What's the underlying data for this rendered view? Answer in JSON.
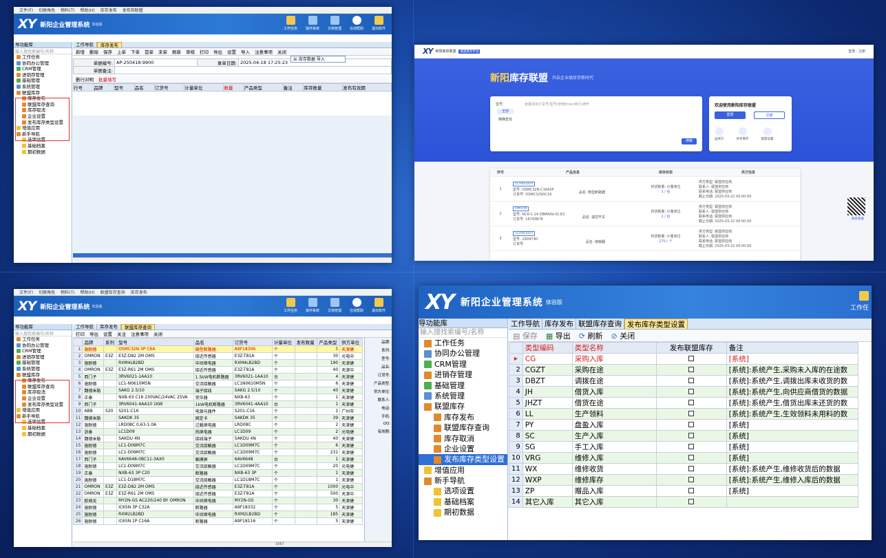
{
  "app": {
    "menus": [
      "文件(F)",
      "切换角色",
      "物料(T)",
      "帮助(H)",
      "库存发布",
      "发布到联盟"
    ],
    "title": "新阳企业管理系统",
    "trial": "体验版",
    "header_buttons": [
      "工作任务",
      "操作系统",
      "文档管理",
      "在线帮助",
      "退出软件"
    ],
    "logo": "XY",
    "sidebar_header": "导功能库",
    "sidebar_search": "输入搜找索编号/名称",
    "tree": [
      {
        "label": "工作任务",
        "level": 0,
        "icon": "task-icon"
      },
      {
        "label": "协同办公管理",
        "level": 0,
        "icon": "office-icon"
      },
      {
        "label": "CRM管理",
        "level": 0,
        "icon": "crm-icon"
      },
      {
        "label": "进销存管理",
        "level": 0,
        "icon": "stock-icon"
      },
      {
        "label": "基础管理",
        "level": 0,
        "icon": "base-icon"
      },
      {
        "label": "系统管理",
        "level": 0,
        "icon": "system-icon"
      },
      {
        "label": "联盟库存",
        "level": 0,
        "icon": "union-icon"
      },
      {
        "label": "库存发布",
        "level": 1,
        "icon": "publish-icon"
      },
      {
        "label": "联盟库存查询",
        "level": 1,
        "icon": "query-icon"
      },
      {
        "label": "库存取消",
        "level": 1,
        "icon": "cancel-icon"
      },
      {
        "label": "企业设置",
        "level": 1,
        "icon": "company-icon"
      },
      {
        "label": "发布库存类型设置",
        "level": 1,
        "icon": "type-icon"
      },
      {
        "label": "增值应用",
        "level": 0,
        "icon": "app-icon"
      },
      {
        "label": "新手导航",
        "level": 0,
        "icon": "guide-icon"
      },
      {
        "label": "选项设置",
        "level": 1,
        "icon": "folder-icon"
      },
      {
        "label": "基础档案",
        "level": 1,
        "icon": "folder-icon"
      },
      {
        "label": "期初数据",
        "level": 1,
        "icon": "folder-icon"
      }
    ]
  },
  "p1": {
    "tabs": [
      "工作导航",
      "库存发布"
    ],
    "toolbar": [
      "新增",
      "删除",
      "保存",
      "上单",
      "下单",
      "首单",
      "末单",
      "刷新",
      "审核",
      "打印",
      "导出",
      "设置",
      "导入",
      "注意事项",
      "关闭"
    ],
    "import_menu": "从 库存数据 导入",
    "form": {
      "doc_no_label": "单据编号:",
      "doc_no": "AP-250418-9900",
      "date_label": "录单日期:",
      "date": "2025-04-18 17:25:23",
      "remark_label": "单据备注:"
    },
    "subbar": [
      "删行对明",
      "批量填写"
    ],
    "columns": [
      "行号",
      "品牌",
      "型号",
      "品名",
      "订货号",
      "计量单位",
      "数量",
      "产品类型",
      "备注",
      "库存数量",
      "发布有效期"
    ]
  },
  "p2": {
    "top_left": "新阳库存联盟",
    "top_badge": "联盟库存平台",
    "top_right": "登录 · 注册",
    "hero_title_a": "新阳",
    "hero_title_b": "库存联盟",
    "hero_sub": "开启企业级库存新时代",
    "search_label": "型号:",
    "search_placeholder": "批量添加订货号/型号(使用Enter换行)搜开",
    "tab_a": "全部",
    "tab_b": "精确查找",
    "search_btn": "搜索",
    "welcome": "欢迎使用新阳库存联盟",
    "login_btn": "登录",
    "register_btn": "注册",
    "quick": [
      "品牌方",
      "共享库存",
      "联盟设置"
    ],
    "cols": [
      "序号",
      "产品信息",
      "库存状态",
      "供方信息"
    ],
    "rows": [
      {
        "no": "1",
        "brand": "SCHNEIDER",
        "model": "型号: OSMC32N-C16A3P",
        "order": "订货号: OSMC32N3C16",
        "name": "品名: 微型断路器",
        "stock": "供货数量: 计量单位",
        "qty": "1 / 台",
        "supplier": "供方类型: 联盟供应商",
        "contact": "联系人: 联盟供应商",
        "phone": "联系电话: 联盟供应商",
        "update": "截止日期: 2025-03-22 00:00:00"
      },
      {
        "no": "2",
        "brand": "OMRON",
        "model": "型号: NCR-C-24 DBMAIN-01-E2",
        "order": "订货号: 16793B76",
        "name": "品名: 温控开关",
        "stock": "供货数量: 计量单位",
        "qty": "1 / 台",
        "supplier": "供方类型: 联盟供应商",
        "contact": "联系人: 联盟供应商",
        "phone": "联系电话: 联盟供应商",
        "update": "截止日期: 2025-03-22 00:00:00"
      },
      {
        "no": "3",
        "brand": "SCHNEIDER",
        "model": "型号: 29D8740",
        "order": "订货号:",
        "name": "品名: 接触器",
        "stock": "供货数量: 计量单位",
        "qty": "170 / 个",
        "supplier": "供方类型: 联盟供应商",
        "contact": "联系人: 联盟供应商",
        "phone": "联系电话: 联盟供应商",
        "update": "截止日期: 2025-03-22 00:00:00"
      }
    ],
    "qr_label": "联系客服"
  },
  "p3": {
    "tabs": [
      "工作导航",
      "库存发布",
      "联盟库存查询"
    ],
    "toolbar": [
      "打印",
      "导出",
      "设置",
      "关注",
      "注意事项",
      "关闭"
    ],
    "columns": [
      "品牌",
      "系列",
      "型号",
      "品名",
      "订货号",
      "计量单位",
      "发布数量",
      "产品类型",
      "供方单位"
    ],
    "rows": [
      [
        "施耐德",
        "",
        "OSMC32N 3P C6A",
        "微型断路器",
        "A9F18306",
        "个",
        "5",
        "天津捷"
      ],
      [
        "OMRON",
        "E3Z",
        "E3Z-D82 2M OMS",
        "接近传感器",
        "E3Z-T81A",
        "个",
        "30",
        "光电中"
      ],
      [
        "施耐德",
        "",
        "RXM4LB2BD",
        "中间继电器",
        "RXM4LB2BD",
        "个",
        "190",
        "天津捷"
      ],
      [
        "OMRON",
        "E3Z",
        "E3Z-R61 2M OMS",
        "接近传感器",
        "E3Z-T81A",
        "个",
        "40",
        "天津中"
      ],
      [
        "西门子",
        "",
        "3RV6021-1AA10",
        "1.5kW电机断路器",
        "3RV6021-1AA10",
        "台",
        "4",
        "天津捷"
      ],
      [
        "施耐德",
        "",
        "LC1-N0610M5N",
        "交流接触器",
        "LC1N0610M5N",
        "个",
        "6",
        "天津捷"
      ],
      [
        "魏德米勒",
        "",
        "SAKG 2.5/10",
        "端子接线",
        "SAKG 2.5/10",
        "个",
        "40",
        "天津捷"
      ],
      [
        "正泰",
        "",
        "NXB-63 C16 230VAC/24VAC 25VA",
        "变压器",
        "NXB-63",
        "个",
        "1",
        "天津捷"
      ],
      [
        "西门子",
        "",
        "3RV6041-4AA10 1KW",
        "1kW电机断路器",
        "3RV6041-4AA10",
        "台",
        "1",
        "天津捷"
      ],
      [
        "ABB",
        "S20",
        "S201-C16",
        "电源与器件",
        "S201-C16",
        "个",
        "1",
        "广州市"
      ],
      [
        "魏德米勒",
        "",
        "SAKDK 35",
        "固定卡",
        "SAKDK 35",
        "个",
        "39",
        "天津捷"
      ],
      [
        "施耐德",
        "",
        "LRD08C 0.63-1.0A",
        "过载继电器",
        "LRD08C",
        "个",
        "2",
        "天津捷"
      ],
      [
        "浙泰",
        "",
        "LC1D09",
        "热继电器",
        "LC1D09",
        "个",
        "2",
        "光电捷"
      ],
      [
        "魏德米勒",
        "",
        "SAKDU 4N",
        "接线端子",
        "SAKDU 4N",
        "个",
        "40",
        "天津捷"
      ],
      [
        "施耐德",
        "",
        "LC1-D09M7C",
        "交流接触器",
        "LC1D09M7C",
        "个",
        "6",
        "天津捷"
      ],
      [
        "施耐德",
        "",
        "LC1-D09M7C",
        "交流接触器",
        "LC1D09M7C",
        "个",
        "231",
        "天津捷"
      ],
      [
        "西门子",
        "",
        "6AV6648-0BC11-3AX0",
        "触摸屏",
        "6AV6648",
        "台",
        "1",
        "天津捷"
      ],
      [
        "施耐德",
        "",
        "LC1-D09M7C",
        "交流接触器",
        "LC1D09M7C",
        "个",
        "20",
        "光电捷"
      ],
      [
        "正泰",
        "",
        "NXB-63 3P C20",
        "断路器",
        "NXB-63 3P",
        "个",
        "1",
        "天津捷"
      ],
      [
        "施耐德",
        "",
        "LC1-D18M7C",
        "交流接触器",
        "LC1D18M7C",
        "个",
        "1",
        "天津捷"
      ],
      [
        "OMRON",
        "E3Z",
        "E3Z-D82 2M OMS",
        "接近传感器",
        "E3Z-T81A",
        "个",
        "1000",
        "光电中"
      ],
      [
        "OMRON",
        "E3Z",
        "E3Z-R61 2M OMS",
        "接近传感器",
        "E3Z-T81A",
        "个",
        "500",
        "天津中"
      ],
      [
        "欧姆龙",
        "",
        "MY2N-GS AC220/240 BY OMRON",
        "中间继电器",
        "MY2N-GS",
        "个",
        "30",
        "天津捷"
      ],
      [
        "施耐德",
        "",
        "IC65N 3P C32A",
        "断路器",
        "A9F18332",
        "个",
        "5",
        "天津捷"
      ],
      [
        "施耐德",
        "",
        "RXM2LB2BD",
        "中间继电器",
        "RXM2LB2BD",
        "个",
        "185",
        "天津捷"
      ],
      [
        "施耐德",
        "",
        "iC65N 1P C16A",
        "断路器",
        "A9F18116",
        "个",
        "5",
        "天津捷"
      ]
    ],
    "total": "1667",
    "right_labels": [
      "品牌:",
      "系列:",
      "型号:",
      "品名:",
      "订货号:",
      "产品类型:",
      "供方单位:",
      "联系人:",
      "电话:",
      "手机:",
      "QQ:",
      "有效期:"
    ]
  },
  "p4": {
    "tabs": [
      "工作导航",
      "库存发布",
      "联盟库存查询",
      "发布库存类型设置"
    ],
    "toolbar": {
      "save": "保存",
      "export": "导出",
      "refresh": "刷新",
      "close": "关闭"
    },
    "columns": [
      "类型编码",
      "类型名称",
      "发布联盟库存",
      "备注"
    ],
    "rows": [
      {
        "n": "",
        "code": "CG",
        "name": "采购入库",
        "note": "[系统]"
      },
      {
        "n": "2",
        "code": "CGZT",
        "name": "采购在途",
        "note": "[系统]:系统产生,采购未入库的在途数"
      },
      {
        "n": "3",
        "code": "DBZT",
        "name": "调拨在途",
        "note": "[系统]:系统产生,调拨出库未收货的数"
      },
      {
        "n": "4",
        "code": "JH",
        "name": "借货入库",
        "note": "[系统]:系统产生,向供应商借货的数据"
      },
      {
        "n": "5",
        "code": "JHZT",
        "name": "借货在途",
        "note": "[系统]:系统产生,借货出库未还货的数"
      },
      {
        "n": "6",
        "code": "LL",
        "name": "生产领料",
        "note": "[系统]:系统产生,生效领料未用料的数"
      },
      {
        "n": "7",
        "code": "PY",
        "name": "盘盈入库",
        "note": "[系统]"
      },
      {
        "n": "8",
        "code": "SC",
        "name": "生产入库",
        "note": "[系统]"
      },
      {
        "n": "9",
        "code": "SG",
        "name": "手工入库",
        "note": "[系统]"
      },
      {
        "n": "10",
        "code": "VRG",
        "name": "维修入库",
        "note": "[系统]"
      },
      {
        "n": "11",
        "code": "WX",
        "name": "维修收货",
        "note": "[系统]:系统产生,维修收货后的数据"
      },
      {
        "n": "12",
        "code": "WXP",
        "name": "维修库存",
        "note": "[系统]:系统产生,维修入库后的数据"
      },
      {
        "n": "13",
        "code": "ZP",
        "name": "赠品入库",
        "note": "[系统]"
      },
      {
        "n": "14",
        "code": "其它入库",
        "name": "其它入库",
        "note": ""
      }
    ],
    "header_right": "工作任"
  }
}
